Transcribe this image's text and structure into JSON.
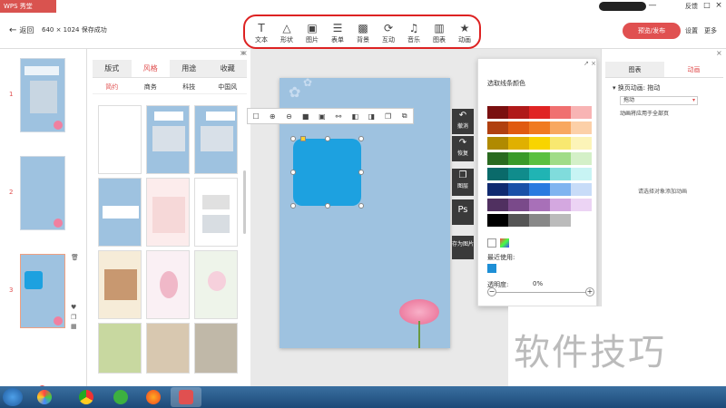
{
  "titlebar": {
    "app_name": "WPS 秀堂",
    "feedback": "反馈",
    "minimize": "—",
    "maximize": "□",
    "close": "×"
  },
  "header": {
    "back": "返回",
    "size_status": "640 × 1024 保存成功",
    "publish": "预览/发布",
    "settings": "设置",
    "more": "更多"
  },
  "toolbar": [
    {
      "label": "文本",
      "icon": "text-icon",
      "glyph": "T"
    },
    {
      "label": "形状",
      "icon": "shape-icon",
      "glyph": "△"
    },
    {
      "label": "图片",
      "icon": "image-icon",
      "glyph": "▣"
    },
    {
      "label": "表单",
      "icon": "form-icon",
      "glyph": "☰"
    },
    {
      "label": "背景",
      "icon": "background-icon",
      "glyph": "▩"
    },
    {
      "label": "互动",
      "icon": "interact-icon",
      "glyph": "⟳"
    },
    {
      "label": "音乐",
      "icon": "music-icon",
      "glyph": "♫"
    },
    {
      "label": "图表",
      "icon": "chart-icon",
      "glyph": "▥"
    },
    {
      "label": "动画",
      "icon": "animation-icon",
      "glyph": "★"
    }
  ],
  "slides": [
    "1",
    "2",
    "3"
  ],
  "templates": {
    "tabs": [
      "版式",
      "风格",
      "用途",
      "收藏"
    ],
    "active_tab": "风格",
    "subtabs": [
      "简约",
      "商务",
      "科技",
      "中国风"
    ],
    "active_subtab": "简约"
  },
  "side_actions": [
    {
      "label": "撤消",
      "glyph": "↶"
    },
    {
      "label": "恢复",
      "glyph": "↷"
    },
    {
      "label": "图层",
      "glyph": "❐"
    },
    {
      "label": "",
      "glyph": "Ps"
    },
    {
      "label": "存为图片",
      "glyph": ""
    }
  ],
  "color_picker": {
    "title": "选取线条颜色",
    "recent_label": "最近使用:",
    "opacity_label": "透明度:",
    "opacity_value": "0%",
    "minus": "−",
    "plus": "+",
    "rows": [
      [
        "#7a1010",
        "#b01a1a",
        "#e02424",
        "#f07070",
        "#f8b4b4"
      ],
      [
        "#b04010",
        "#e05a10",
        "#f07a20",
        "#f8a860",
        "#fcd0a8"
      ],
      [
        "#b08a00",
        "#e0b000",
        "#f8d400",
        "#f8e870",
        "#fcf4b8"
      ],
      [
        "#2a6a20",
        "#3a9a2a",
        "#5ac040",
        "#a0dc88",
        "#d4f0c8"
      ],
      [
        "#0a6a6a",
        "#108c8c",
        "#20b4b4",
        "#80dcdc",
        "#c8f4f4"
      ],
      [
        "#102a70",
        "#1a50a8",
        "#2a7ae0",
        "#80b4f0",
        "#c8dcf8"
      ],
      [
        "#503060",
        "#7a4a8a",
        "#a870b8",
        "#d4a8e0",
        "#ecd4f4"
      ],
      [
        "#000000",
        "#555555",
        "#888888",
        "#bbbbbb",
        "#ffffff"
      ]
    ],
    "recent_color": "#1e8fd6"
  },
  "right_panel": {
    "tabs": [
      "图表",
      "动画"
    ],
    "active_tab": "动画",
    "page_anim_label": "换页动画: 拖动",
    "page_anim_value": "拖动",
    "apply_all": "动画将应用于全部页",
    "empty_hint": "请选择对象添加动画"
  },
  "watermark": "软件技巧",
  "colors": {
    "accent": "#e05050",
    "slide_bg": "#9ec2e0",
    "shape": "#1da1e0"
  }
}
